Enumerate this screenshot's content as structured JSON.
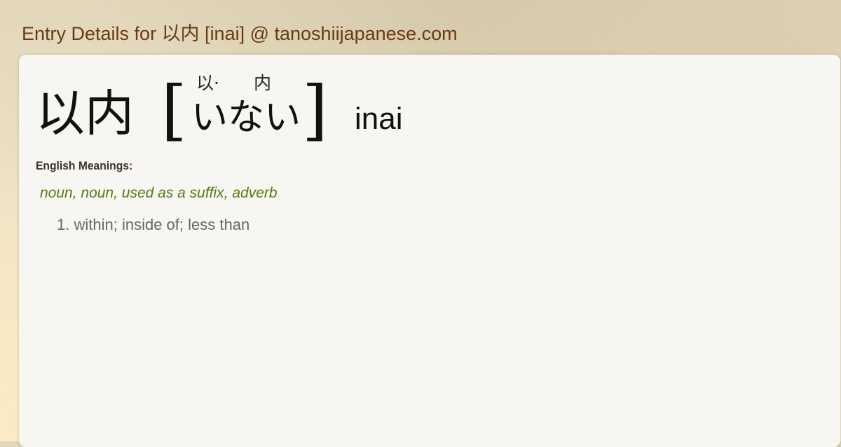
{
  "header": {
    "title": "Entry Details for 以内 [inai] @ tanoshiijapanese.com"
  },
  "entry": {
    "kanji": "以内",
    "bracket_open": "[",
    "bracket_close": "]",
    "furigana": [
      "以·",
      "内"
    ],
    "reading": "いない",
    "romaji": "inai"
  },
  "meanings": {
    "heading": "English Meanings:",
    "part_of_speech": "noun, noun, used as a suffix, adverb",
    "items": [
      {
        "number": "1.",
        "text": "within; inside of; less than"
      }
    ]
  }
}
